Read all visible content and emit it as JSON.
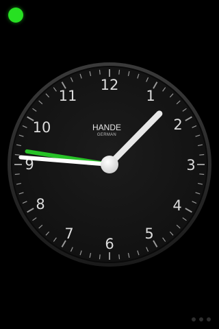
{
  "status_light": {
    "color": "#27e022",
    "icon": "status-dot-icon"
  },
  "clock": {
    "brand": "HANDE",
    "brand_sub": "GERMAN",
    "numerals": [
      "12",
      "1",
      "2",
      "3",
      "4",
      "5",
      "6",
      "7",
      "8",
      "9",
      "10",
      "11"
    ],
    "time": {
      "hours": 12,
      "minutes": 45,
      "seconds": 46.5
    },
    "colors": {
      "face": "#161616",
      "bezel": "#2a2a2a",
      "hour_hand": "#e8e8e8",
      "minute_hand": "#ffffff",
      "second_hand": "#27c127",
      "tick": "#9a9a9a"
    }
  },
  "page_indicator": {
    "pages": 3,
    "current": 0
  }
}
